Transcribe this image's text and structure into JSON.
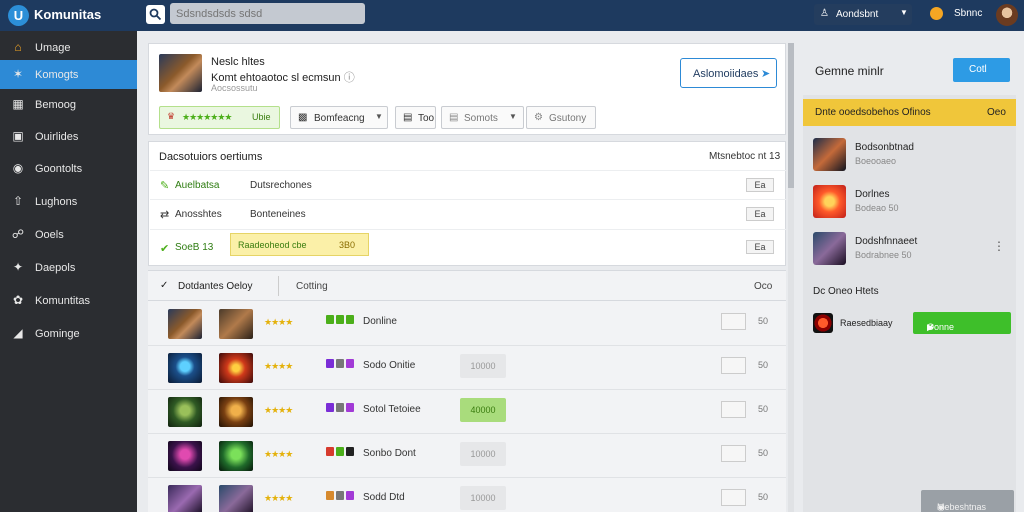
{
  "header": {
    "app_title": "Komunitas",
    "logo_letter": "U",
    "search_placeholder": "Sdsndsdsds sdsd",
    "user_name": "Aondsbnt",
    "coin_label": "Sbnnc"
  },
  "sidebar": {
    "items": [
      {
        "label": "Umage",
        "icon": "home-icon"
      },
      {
        "label": "Komogts",
        "icon": "star-icon",
        "active": true
      },
      {
        "label": "Bemoog",
        "icon": "chart-icon"
      },
      {
        "label": "Ouirlides",
        "icon": "monitor-icon"
      },
      {
        "label": "Goontolts",
        "icon": "gamepad-icon"
      },
      {
        "label": "Lughons",
        "icon": "upload-icon"
      },
      {
        "label": "Ooels",
        "icon": "tag-icon"
      },
      {
        "label": "Daepols",
        "icon": "puzzle-icon"
      },
      {
        "label": "Komuntitas",
        "icon": "group-icon"
      },
      {
        "label": "Gominge",
        "icon": "dropdown-icon"
      }
    ]
  },
  "game": {
    "title": "Neslc hltes",
    "desc": "Komt ehtoaotoc sl ecmsun",
    "sub": "Aocsossutu",
    "primary_button": "Aslomoiidaes",
    "rating_chip": "★★★★★★★",
    "rating_chip_tail": "Ubie",
    "filters": [
      {
        "label": "Bomfeacng"
      },
      {
        "label": "Too"
      },
      {
        "label": "Somots"
      },
      {
        "label": "Gsutony"
      }
    ]
  },
  "details": {
    "heading": "Dacsotuiors oertiums",
    "meta": "Mtsnebtoc nt 13",
    "rows": [
      {
        "name": "Auelbatsa",
        "text": "Dutsrechones",
        "badge": "Ea"
      },
      {
        "name": "Anosshtes",
        "text": "Bonteneines",
        "badge": "Ea"
      },
      {
        "name": "SoeB 13",
        "tag": "Raadeoheod cbe",
        "tag_value": "3B0",
        "badge": "Ea"
      }
    ]
  },
  "table": {
    "tab_active": "Dotdantes Oeloy",
    "tab_second": "Cotting",
    "tab_right": "Oco",
    "rows": [
      {
        "name": "Donline",
        "chip": "",
        "num": "50",
        "stars": "★★★★",
        "icon_colors": [
          "#4caf1a",
          "#4caf1a",
          "#4caf1a"
        ]
      },
      {
        "name": "Sodo Onitie",
        "chip": "10000",
        "num": "50",
        "stars": "★★★★",
        "icon_colors": [
          "#7a2dd6",
          "#777777",
          "#a23ad6"
        ]
      },
      {
        "name": "Sotol Tetoiee",
        "chip": "40000",
        "chip_green": true,
        "num": "50",
        "stars": "★★★★",
        "icon_colors": [
          "#7a2dd6",
          "#777777",
          "#a23ad6"
        ]
      },
      {
        "name": "Sonbo Dont",
        "chip": "10000",
        "num": "50",
        "stars": "★★★★",
        "icon_colors": [
          "#d63a2d",
          "#4caf1a",
          "#222222"
        ]
      },
      {
        "name": "Sodd Dtd",
        "chip": "10000",
        "num": "50",
        "stars": "★★★★",
        "icon_colors": [
          "#d6892d",
          "#777777",
          "#a23ad6"
        ]
      }
    ]
  },
  "right": {
    "heading": "Gemne minlr",
    "button": "Cotl",
    "yellow_left": "Dnte ooedsobehos Ofinos",
    "yellow_right": "Oeo",
    "items": [
      {
        "t1": "Bodsonbtnad",
        "t2": "Boeooaeo"
      },
      {
        "t1": "Dorlnes",
        "t2": "Bodeao 50"
      },
      {
        "t1": "Dodshfnnaeet",
        "t2": "Bodrabnee 50"
      }
    ],
    "section_heading": "Dc Oneo Htets",
    "join_text": "Raesedbiaay",
    "join_button": "Oonne"
  },
  "float_button": "Mebeshtnas",
  "colors": {
    "topbar": "#1e3a5f",
    "sidebar": "#2b2d31",
    "accent": "#2d8ad6",
    "green": "#3ebf2a",
    "yellow": "#f0c63a"
  }
}
